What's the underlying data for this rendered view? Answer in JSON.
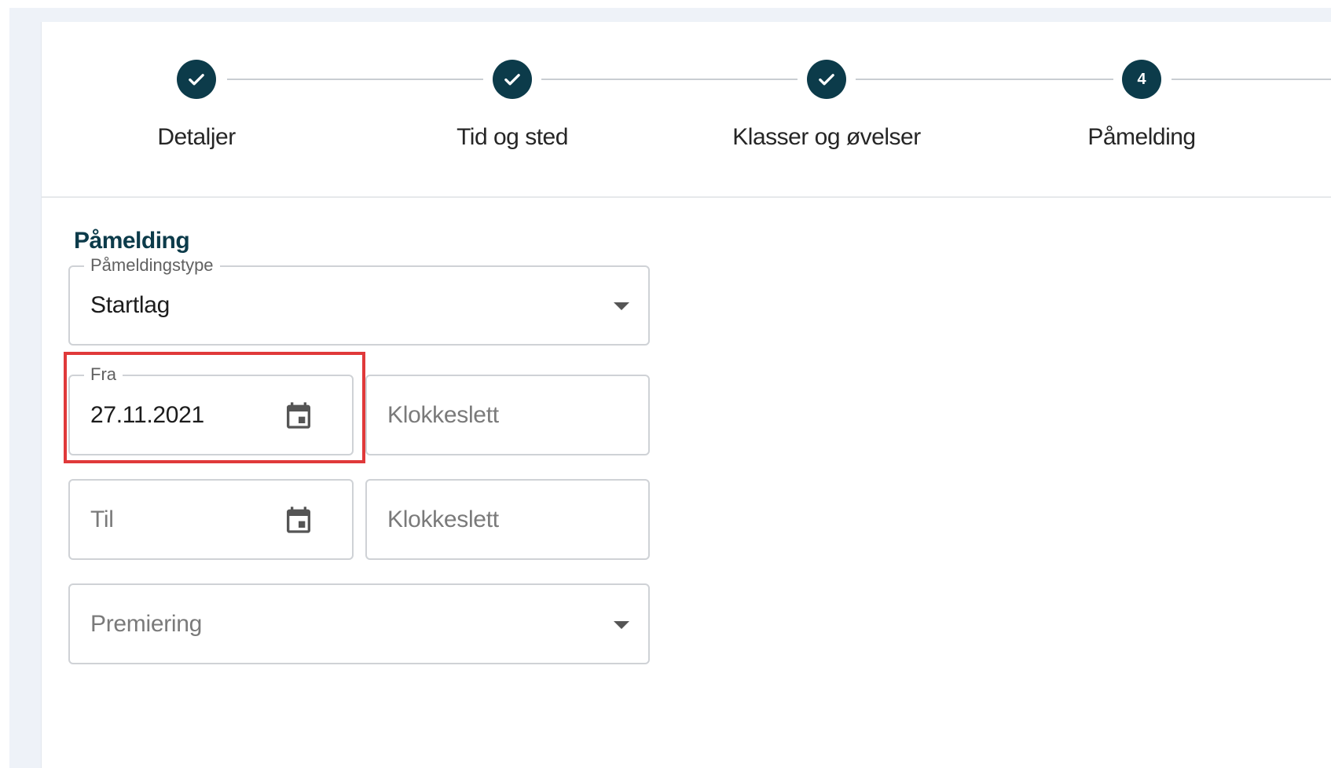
{
  "stepper": {
    "steps": [
      {
        "label": "Detaljer",
        "state": "completed"
      },
      {
        "label": "Tid og sted",
        "state": "completed"
      },
      {
        "label": "Klasser og øvelser",
        "state": "completed"
      },
      {
        "label": "Påmelding",
        "state": "active",
        "number": "4"
      }
    ]
  },
  "form": {
    "section_title": "Påmelding",
    "registration_type": {
      "label": "Påmeldingstype",
      "value": "Startlag"
    },
    "from_date": {
      "label": "Fra",
      "value": "27.11.2021"
    },
    "from_time": {
      "placeholder": "Klokkeslett"
    },
    "to_date": {
      "placeholder": "Til"
    },
    "to_time": {
      "placeholder": "Klokkeslett"
    },
    "prize": {
      "placeholder": "Premiering"
    }
  },
  "colors": {
    "primary": "#0c3b4a",
    "highlight": "#e0393a",
    "border": "#cfd2d6",
    "background": "#eef2f8"
  }
}
